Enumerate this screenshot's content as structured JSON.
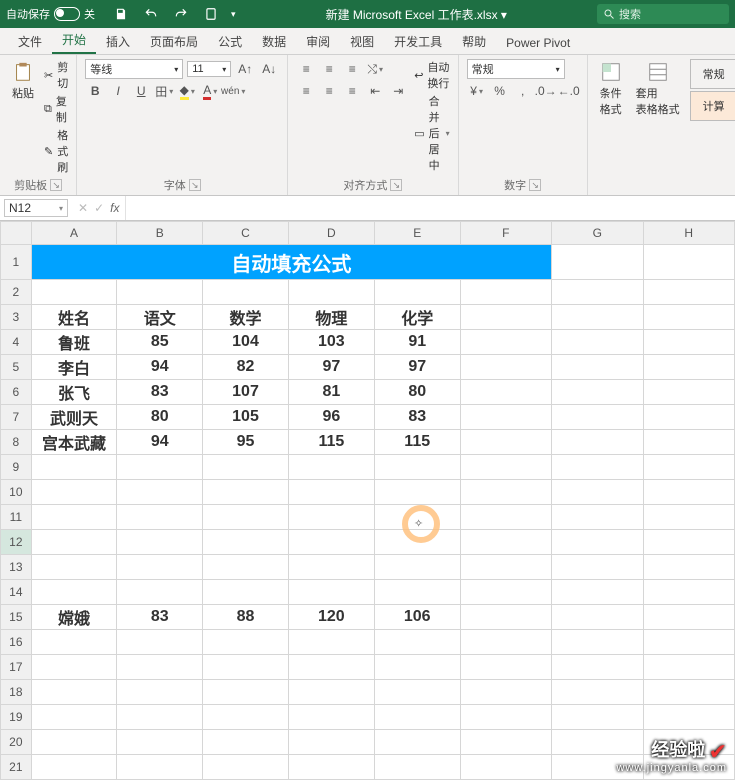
{
  "titlebar": {
    "autosave": "自动保存",
    "autosave_state": "关",
    "filename": "新建 Microsoft Excel 工作表.xlsx  ▾",
    "search_placeholder": "搜索"
  },
  "tabs": [
    "文件",
    "开始",
    "插入",
    "页面布局",
    "公式",
    "数据",
    "审阅",
    "视图",
    "开发工具",
    "帮助",
    "Power Pivot"
  ],
  "active_tab": "开始",
  "ribbon": {
    "clipboard": {
      "paste": "粘贴",
      "cut": "剪切",
      "copy": "复制",
      "formatpainter": "格式刷",
      "label": "剪贴板"
    },
    "font": {
      "family": "等线",
      "size": "11",
      "label": "字体"
    },
    "align": {
      "wrap": "自动换行",
      "merge": "合并后居中",
      "label": "对齐方式"
    },
    "number": {
      "format": "常规",
      "label": "数字"
    },
    "styles": {
      "cond": "条件格式",
      "tbl": "套用\n表格格式",
      "s1": "常规",
      "s2": "计算"
    }
  },
  "namebox": "N12",
  "chart_data": {
    "type": "table",
    "title": "自动填充公式",
    "columns": [
      "姓名",
      "语文",
      "数学",
      "物理",
      "化学"
    ],
    "rows": [
      {
        "姓名": "鲁班",
        "语文": 85,
        "数学": 104,
        "物理": 103,
        "化学": 91
      },
      {
        "姓名": "李白",
        "语文": 94,
        "数学": 82,
        "物理": 97,
        "化学": 97
      },
      {
        "姓名": "张飞",
        "语文": 83,
        "数学": 107,
        "物理": 81,
        "化学": 80
      },
      {
        "姓名": "武则天",
        "语文": 80,
        "数学": 105,
        "物理": 96,
        "化学": 83
      },
      {
        "姓名": "宫本武藏",
        "语文": 94,
        "数学": 95,
        "物理": 115,
        "化学": 115
      }
    ],
    "extra_row": {
      "姓名": "嫦娥",
      "语文": 83,
      "数学": 88,
      "物理": 120,
      "化学": 106
    }
  },
  "cols": [
    "A",
    "B",
    "C",
    "D",
    "E",
    "F",
    "G",
    "H"
  ],
  "watermark": {
    "a": "经验啦",
    "b": "www.jingyanla.com"
  }
}
